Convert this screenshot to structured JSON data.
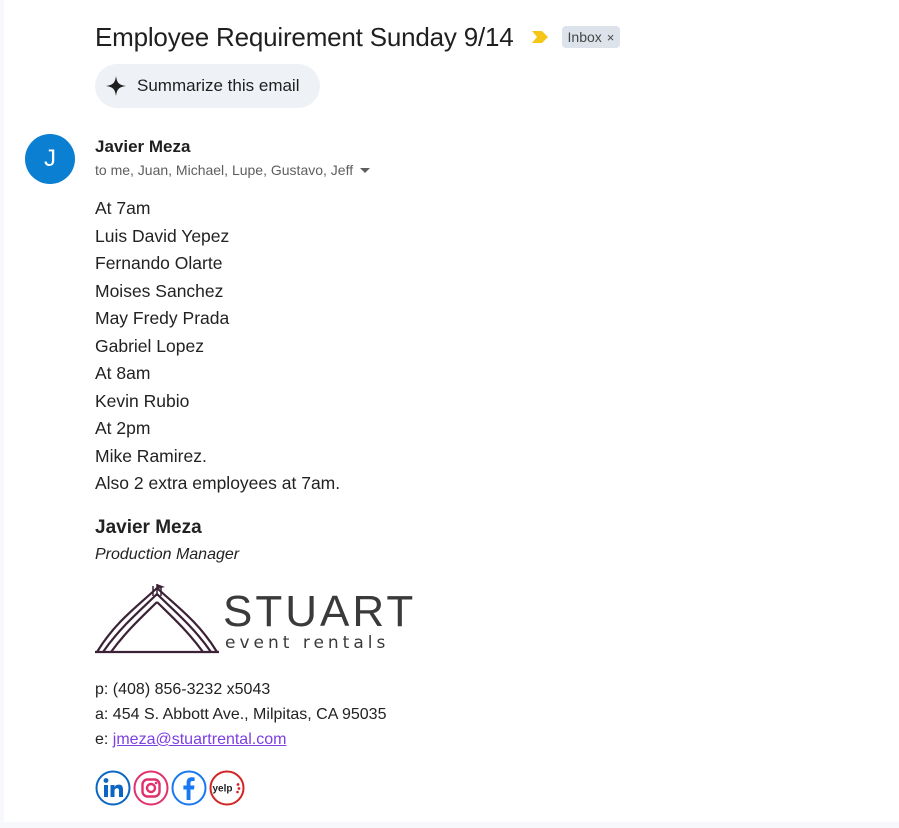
{
  "email": {
    "subject": "Employee Requirement Sunday 9/14",
    "label_chip": "Inbox",
    "label_remove": "×",
    "summarize_label": "Summarize this email",
    "sender": {
      "initial": "J",
      "name": "Javier Meza",
      "recipients": "to me, Juan, Michael, Lupe, Gustavo, Jeff"
    },
    "body_lines": [
      "At 7am",
      "Luis David Yepez",
      "Fernando Olarte",
      "Moises Sanchez",
      "May Fredy Prada",
      "Gabriel Lopez",
      "At 8am",
      "Kevin Rubio",
      "At 2pm",
      "Mike Ramirez.",
      "Also 2 extra employees at 7am."
    ],
    "signature": {
      "name": "Javier Meza",
      "title": "Production Manager",
      "logo_word": "STUART",
      "logo_sub": "event rentals",
      "phone_label": "p:",
      "phone": "(408) 856-3232 x5043",
      "address_label": "a:",
      "address": "454 S. Abbott Ave., Milpitas, CA 95035",
      "email_label": "e:",
      "email": "jmeza@stuartrental.com",
      "social": [
        "linkedin-icon",
        "instagram-icon",
        "facebook-icon",
        "yelp-icon"
      ],
      "yelp_text": "yelp"
    }
  },
  "colors": {
    "avatar": "#0b7fd1",
    "importance": "#f5c518",
    "chip_bg": "#dde3ea",
    "summarize_bg": "#eef1f6",
    "link": "#7b3fe4",
    "logo_dark": "#3b2237",
    "logo_text": "#3a3a3a",
    "linkedin": "#0a66c2",
    "instagram": "#e1306c",
    "facebook": "#1877f2",
    "yelp": "#d32323"
  }
}
